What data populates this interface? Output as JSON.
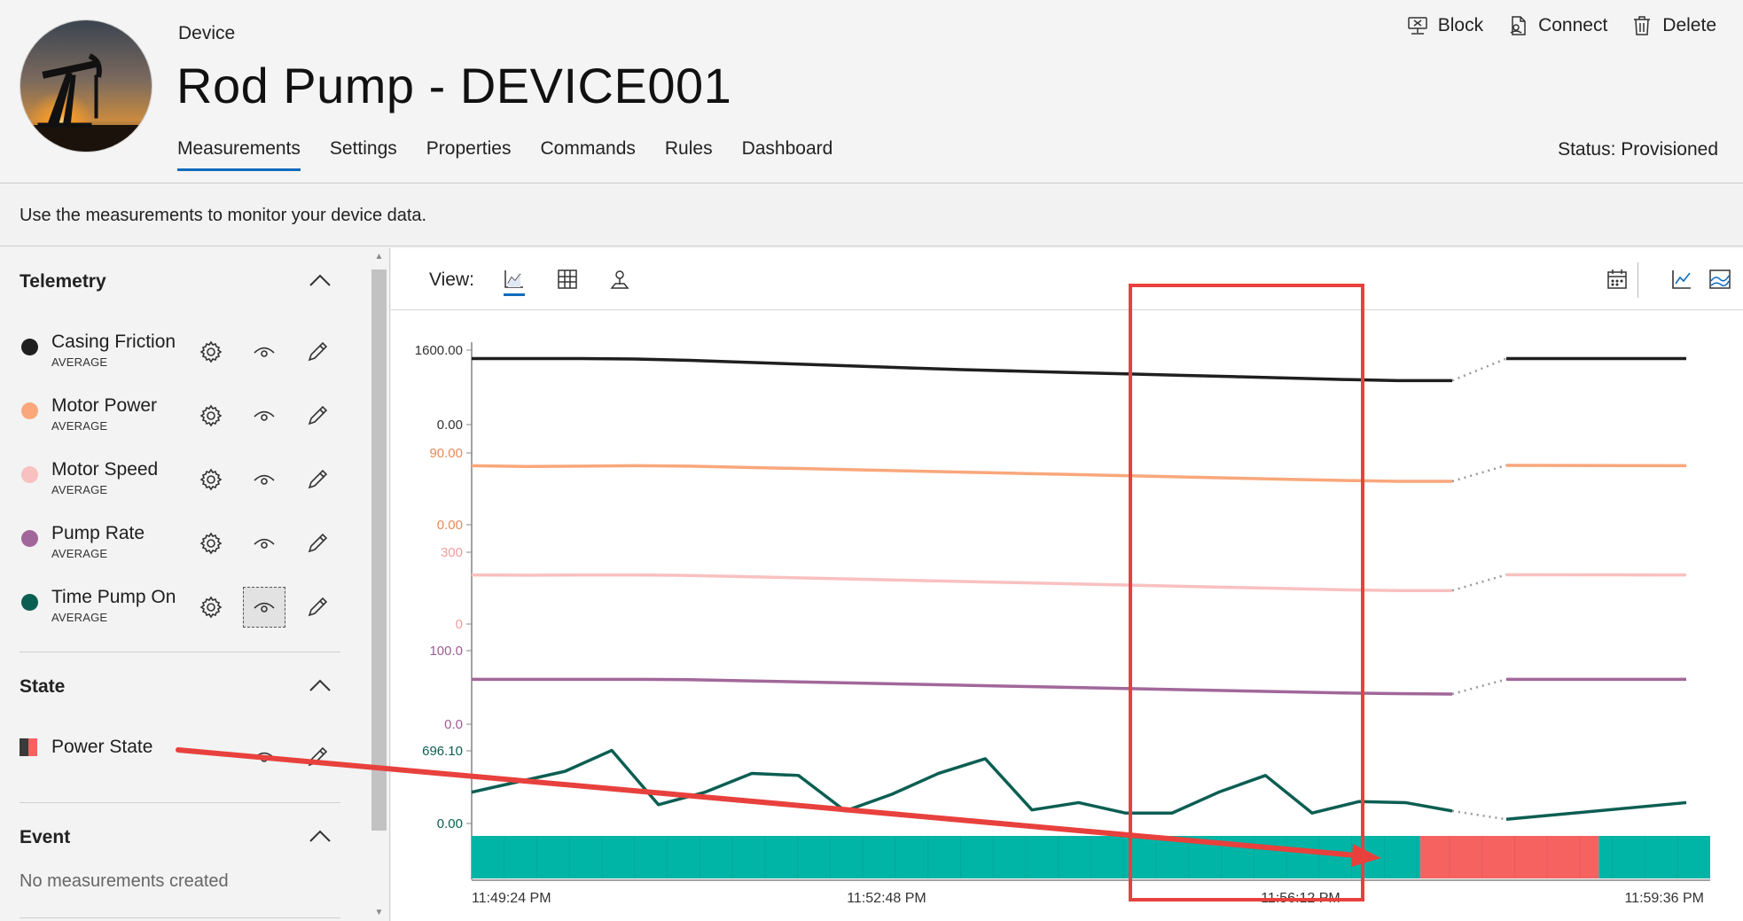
{
  "header": {
    "kind": "Device",
    "title": "Rod Pump - DEVICE001",
    "status": "Status: Provisioned",
    "tabs": [
      {
        "label": "Measurements",
        "active": true
      },
      {
        "label": "Settings"
      },
      {
        "label": "Properties"
      },
      {
        "label": "Commands"
      },
      {
        "label": "Rules"
      },
      {
        "label": "Dashboard"
      }
    ],
    "actions": [
      {
        "label": "Block",
        "icon": "block-icon"
      },
      {
        "label": "Connect",
        "icon": "connect-icon"
      },
      {
        "label": "Delete",
        "icon": "trash-icon"
      }
    ]
  },
  "description": "Use the measurements to monitor your device data.",
  "telemetry": {
    "title": "Telemetry",
    "items": [
      {
        "name": "Casing Friction",
        "agg": "AVERAGE",
        "color": "#1f1f1f"
      },
      {
        "name": "Motor Power",
        "agg": "AVERAGE",
        "color": "#f9a77b"
      },
      {
        "name": "Motor Speed",
        "agg": "AVERAGE",
        "color": "#f9c0c0"
      },
      {
        "name": "Pump Rate",
        "agg": "AVERAGE",
        "color": "#a2679a"
      },
      {
        "name": "Time Pump On",
        "agg": "AVERAGE",
        "color": "#0b5e52"
      }
    ]
  },
  "state": {
    "title": "State",
    "items": [
      {
        "name": "Power State"
      }
    ]
  },
  "event": {
    "title": "Event",
    "empty_text": "No measurements created"
  },
  "view": {
    "label": "View:",
    "icons": [
      "line-chart-icon",
      "grid-icon",
      "map-pin-icon"
    ],
    "right_icons": [
      "calendar-icon",
      "trend-icon",
      "area-chart-icon"
    ]
  },
  "colors": {
    "accent": "#0f6cbd",
    "state_on": "#00b5a5",
    "state_off": "#f56260",
    "highlight": "#e8413d"
  },
  "chart_data": {
    "type": "line",
    "x_ticks": [
      "11:49:24 PM",
      "11:52:48 PM",
      "11:56:12 PM",
      "11:59:36 PM"
    ],
    "series": [
      {
        "name": "Casing Friction",
        "color": "#1f1f1f",
        "axis_top": "1600.00",
        "axis_bottom": "0.00",
        "ylim": [
          0,
          1600
        ],
        "values": [
          1420,
          1420,
          1418,
          1410,
          1380,
          1340,
          1300,
          1260,
          1220,
          1180,
          1150,
          1120,
          1090,
          1060,
          1030,
          1000,
          970,
          945,
          945
        ],
        "gap_end": 1420,
        "after": [
          1420,
          1420
        ]
      },
      {
        "name": "Motor Power",
        "color": "#f9a77b",
        "axis_top": "90.00",
        "axis_bottom": "0.00",
        "ylim": [
          0,
          90
        ],
        "values": [
          74,
          73,
          73.5,
          74,
          73.5,
          72,
          70.5,
          69,
          67.5,
          66,
          64.5,
          63,
          61.5,
          60,
          58.5,
          57,
          55.5,
          54.5,
          54.5
        ],
        "gap_end": 74.5,
        "after": [
          74.5,
          74
        ]
      },
      {
        "name": "Motor Speed",
        "color": "#f9c0c0",
        "axis_top": "300",
        "axis_bottom": "0",
        "ylim": [
          0,
          300
        ],
        "values": [
          205,
          204,
          205,
          205,
          203,
          198,
          193,
          188,
          183,
          178,
          173,
          168,
          163,
          158,
          153,
          148,
          143,
          140,
          140
        ],
        "gap_end": 206,
        "after": [
          206,
          205
        ]
      },
      {
        "name": "Pump Rate",
        "color": "#a2679a",
        "axis_top": "100.0",
        "axis_bottom": "0.0",
        "ylim": [
          0,
          100
        ],
        "values": [
          61,
          61,
          61,
          61,
          60.5,
          59,
          57.5,
          56,
          54.5,
          53,
          51.5,
          50,
          48.5,
          47,
          45.5,
          44,
          42.5,
          41.5,
          41
        ],
        "gap_end": 61,
        "after": [
          61,
          61
        ]
      },
      {
        "name": "Time Pump On",
        "color": "#0b5e52",
        "axis_top": "696.10",
        "axis_bottom": "0.00",
        "ylim": [
          0,
          696.1
        ],
        "values": [
          300,
          400,
          500,
          700,
          180,
          300,
          480,
          460,
          120,
          280,
          480,
          620,
          130,
          200,
          100,
          100,
          300,
          460,
          100,
          210,
          200,
          120
        ],
        "gap_end": 40,
        "after": [
          40,
          200
        ]
      }
    ],
    "state_bar": {
      "name": "Power State",
      "segments": [
        {
          "state": "on",
          "start": 0.0,
          "end": 0.766
        },
        {
          "state": "off",
          "start": 0.766,
          "end": 0.91
        },
        {
          "state": "on",
          "start": 0.91,
          "end": 1.0
        }
      ]
    }
  }
}
